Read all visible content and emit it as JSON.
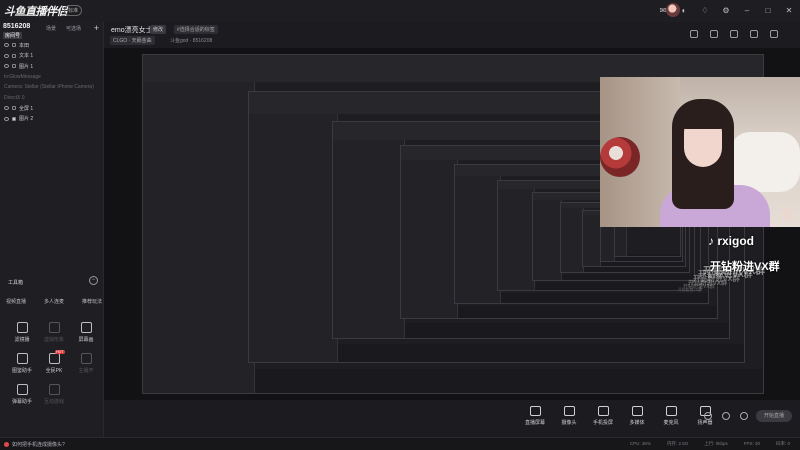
{
  "app": {
    "logo": "斗鱼直播伴侣",
    "badge": "标准"
  },
  "room": {
    "id": "8516208",
    "name": "房间号"
  },
  "sidebar": {
    "tabs": [
      "场景",
      "可选场"
    ],
    "layers": [
      {
        "label": "本田",
        "dim": false,
        "locked": false
      },
      {
        "label": "文本 1",
        "dim": false,
        "locked": false
      },
      {
        "label": "图片 1",
        "dim": false,
        "locked": false
      },
      {
        "label": "tv:GlowMessage",
        "dim": true,
        "locked": false
      },
      {
        "label": "Camera: Stellar (Stellar iPhone Camera)",
        "dim": true,
        "locked": false
      },
      {
        "label": "DirectX 0",
        "dim": true,
        "locked": false
      },
      {
        "label": "全屏 1",
        "dim": false,
        "locked": false
      },
      {
        "label": "图片 2",
        "dim": false,
        "locked": true
      }
    ]
  },
  "tools": {
    "title": "工具箱",
    "tabs": [
      "视频直播",
      "多人连麦",
      "推荐玩法"
    ],
    "items": [
      {
        "label": "滤镜播",
        "icon": "filter-icon",
        "dim": false,
        "hot": false
      },
      {
        "label": "虚拟形象",
        "icon": "avatar-icon",
        "dim": true,
        "hot": false
      },
      {
        "label": "屏幕画",
        "icon": "screen-draw-icon",
        "dim": false,
        "hot": false
      },
      {
        "label": "图鉴助手",
        "icon": "guide-icon",
        "dim": false,
        "hot": false
      },
      {
        "label": "全民PK",
        "icon": "pk-icon",
        "dim": false,
        "hot": true
      },
      {
        "label": "主播开",
        "icon": "host-icon",
        "dim": true,
        "hot": false
      },
      {
        "label": "弹幕助手",
        "icon": "danmaku-icon",
        "dim": false,
        "hot": false
      },
      {
        "label": "互动游戏",
        "icon": "game-icon",
        "dim": true,
        "hot": false
      }
    ],
    "hot_label": "HOT"
  },
  "header": {
    "title": "emo漂亮女士",
    "edit_label": "修改",
    "category": "#选择合适的标签",
    "tag": "CLGO · 天籁金曲",
    "meta": "斗鱼god · 8516208"
  },
  "overlay": {
    "tiktok": "♪ rxigod",
    "promo": "开钻粉进VX群"
  },
  "controls": {
    "items": [
      "直播屏幕",
      "摄像头",
      "手机投屏",
      "多媒体",
      "麦克风",
      "扬声器"
    ],
    "live_button": "开始直播"
  },
  "status": {
    "tip": "如何把手机连成摄像头?",
    "metrics": [
      "CPU: 36%",
      "内存: 2.5G",
      "上行: 0kbps",
      "FPS: 30",
      "码率: 0"
    ]
  }
}
